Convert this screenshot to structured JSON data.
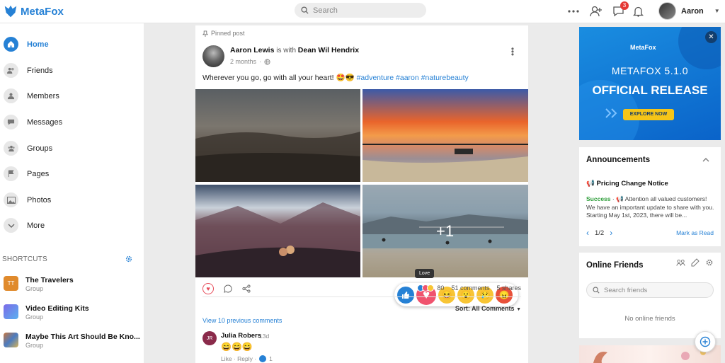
{
  "brand": {
    "name": "MetaFox"
  },
  "header": {
    "search_placeholder": "Search",
    "messages_badge": "3",
    "user_name": "Aaron"
  },
  "sidebar": {
    "items": [
      {
        "label": "Home",
        "icon": "home-icon",
        "active": true
      },
      {
        "label": "Friends",
        "icon": "friends-icon"
      },
      {
        "label": "Members",
        "icon": "members-icon"
      },
      {
        "label": "Messages",
        "icon": "messages-icon"
      },
      {
        "label": "Groups",
        "icon": "groups-icon"
      },
      {
        "label": "Pages",
        "icon": "flag-icon"
      },
      {
        "label": "Photos",
        "icon": "photos-icon"
      },
      {
        "label": "More",
        "icon": "chevron-down-icon"
      }
    ],
    "shortcuts_title": "SHORTCUTS",
    "shortcuts": [
      {
        "title": "The Travelers",
        "sub": "Group",
        "thumb": "TT",
        "color": "#e08a2c"
      },
      {
        "title": "Video Editing Kits",
        "sub": "Group",
        "thumb": "",
        "color": "#7b6ae8"
      },
      {
        "title": "Maybe This Art Should Be Kno...",
        "sub": "Group",
        "thumb": "",
        "color": "#c9763b"
      }
    ]
  },
  "post": {
    "pinned_label": "Pinned post",
    "author": "Aaron Lewis",
    "with_text": "is with",
    "tagged": "Dean Wil Hendrix",
    "time": "2 months",
    "text": "Wherever you go, go with all your heart! 🤩😎",
    "hashtags": "#adventure #aaron #naturebeauty",
    "more_photos": "+1",
    "love_tooltip": "Love",
    "reaction_count": "80",
    "comments_count": "51 comments",
    "shares_count": "5 shares",
    "sort_label": "Sort: All Comments",
    "view_previous": "View 10 previous comments",
    "comment": {
      "initials": "JR",
      "name": "Julia Robers",
      "time": "13d",
      "body": "😄😄😄",
      "actions": "Like · Reply ·",
      "likes": "1"
    }
  },
  "ad": {
    "logo": "MetaFox",
    "version": "METAFOX 5.1.0",
    "title": "OFFICIAL RELEASE",
    "button": "EXPLORE NOW"
  },
  "announcements": {
    "title": "Announcements",
    "item_title": "Pricing Change Notice",
    "status": "Success",
    "body": "Attention all valued customers! We have an important update to share with you. Starting May 1st, 2023, there will be...",
    "page": "1/2",
    "mark_read": "Mark as Read"
  },
  "online_friends": {
    "title": "Online Friends",
    "search_placeholder": "Search friends",
    "empty": "No online friends"
  },
  "colors": {
    "accent": "#2681d5",
    "love": "#f0536e",
    "badge": "#e53935"
  }
}
